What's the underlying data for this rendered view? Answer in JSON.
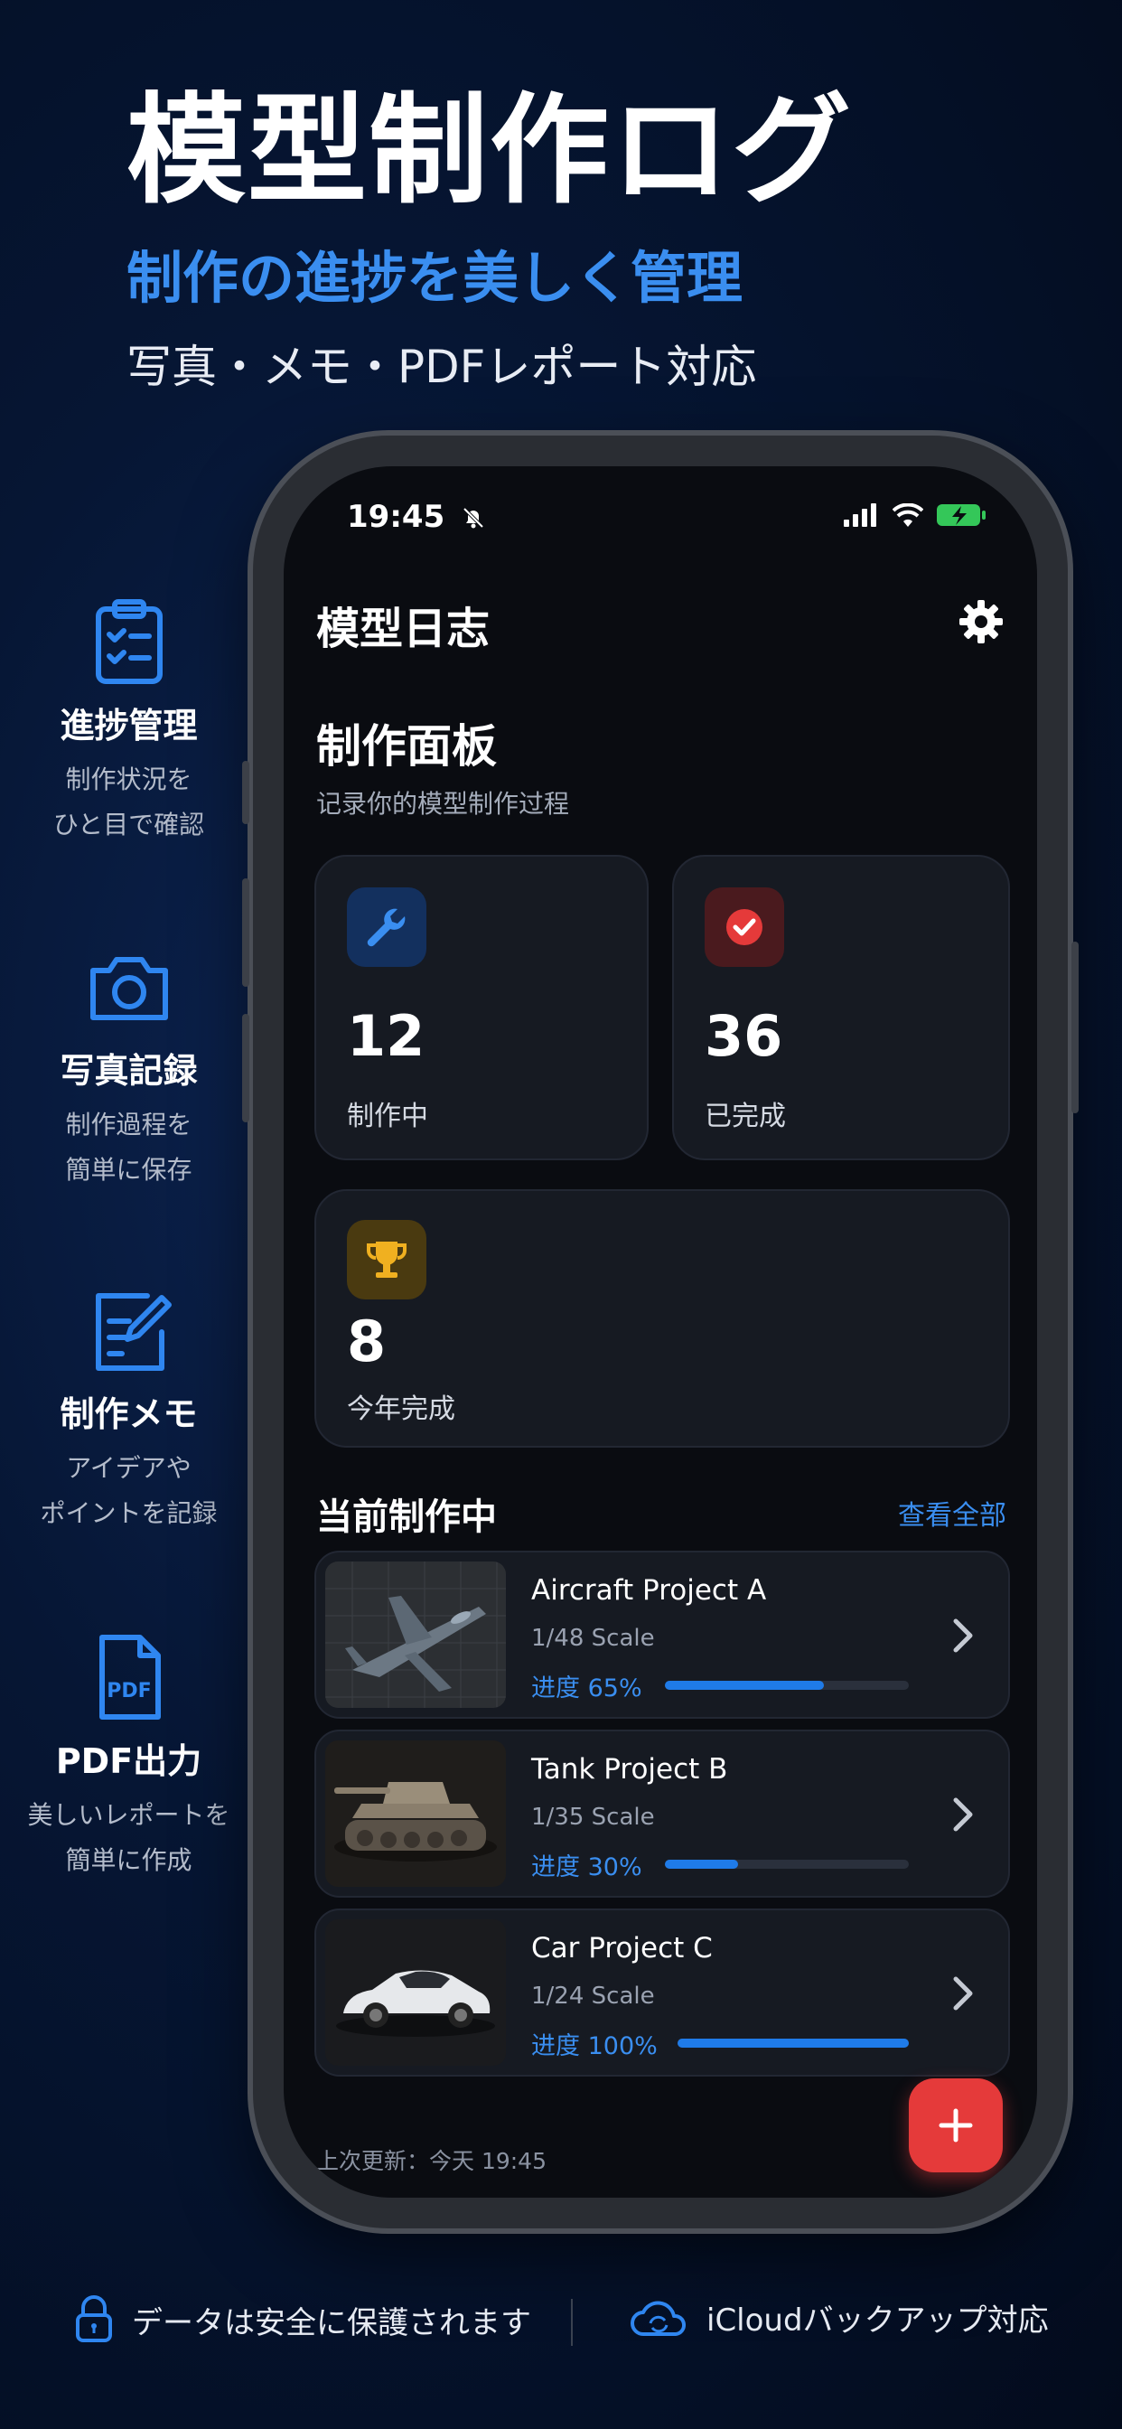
{
  "hero": {
    "title": "模型制作ログ",
    "subtitle": "制作の進捗を美しく管理",
    "tagline": "写真・メモ・PDFレポート対応"
  },
  "features": [
    {
      "icon": "clipboard-checklist-icon",
      "title": "進捗管理",
      "desc1": "制作状況を",
      "desc2": "ひと目で確認"
    },
    {
      "icon": "camera-icon",
      "title": "写真記録",
      "desc1": "制作過程を",
      "desc2": "簡単に保存"
    },
    {
      "icon": "note-edit-icon",
      "title": "制作メモ",
      "desc1": "アイデアや",
      "desc2": "ポイントを記録"
    },
    {
      "icon": "pdf-file-icon",
      "title": "PDF出力",
      "desc1": "美しいレポートを",
      "desc2": "簡単に作成"
    }
  ],
  "status_bar": {
    "time": "19:45"
  },
  "app": {
    "title": "模型日志",
    "section_title": "制作面板",
    "section_sub": "记录你的模型制作过程",
    "stats": [
      {
        "icon": "wrench-icon",
        "value": "12",
        "label": "制作中"
      },
      {
        "icon": "check-circle-icon",
        "value": "36",
        "label": "已完成"
      },
      {
        "icon": "trophy-icon",
        "value": "8",
        "label": "今年完成"
      }
    ],
    "current_title": "当前制作中",
    "view_all": "查看全部",
    "projects": [
      {
        "name": "Aircraft Project A",
        "scale": "1/48 Scale",
        "progress_text": "进度 65%",
        "progress": 0.65
      },
      {
        "name": "Tank Project B",
        "scale": "1/35 Scale",
        "progress_text": "进度 30%",
        "progress": 0.3
      },
      {
        "name": "Car Project C",
        "scale": "1/24 Scale",
        "progress_text": "进度 100%",
        "progress": 1.0
      }
    ],
    "last_update": "上次更新：今天 19:45"
  },
  "footer": {
    "security": "データは安全に保護されます",
    "icloud": "iCloudバックアップ対応"
  },
  "colors": {
    "accent": "#3a8ef0",
    "fab": "#e53a3a",
    "trophy": "#f0b020"
  }
}
